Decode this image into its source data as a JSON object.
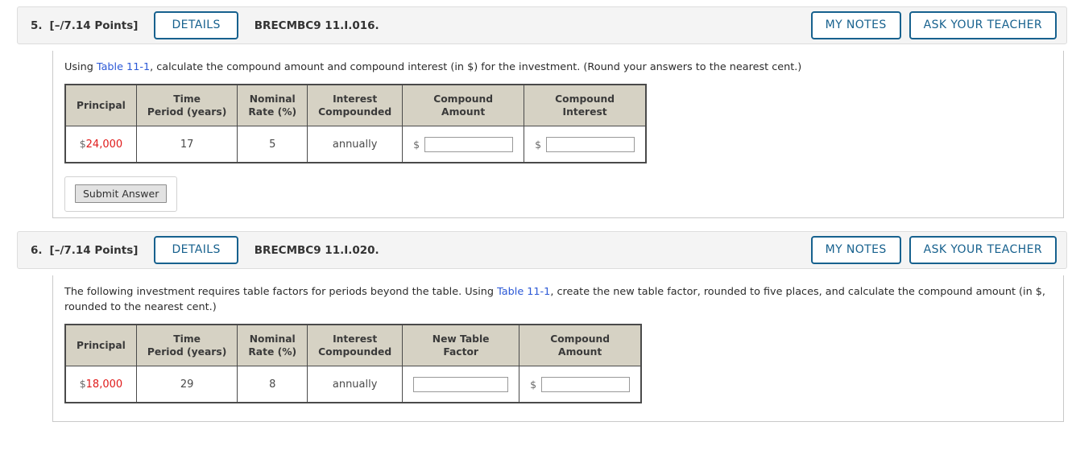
{
  "problems": [
    {
      "number": "5.",
      "points": "[–/7.14 Points]",
      "details_label": "DETAILS",
      "code": "BRECMBC9 11.I.016.",
      "my_notes_label": "MY NOTES",
      "ask_teacher_label": "ASK YOUR TEACHER",
      "question": {
        "before_link": "Using ",
        "link": "Table 11-1",
        "after_link": ", calculate the compound amount and compound interest (in $) for the investment. (Round your answers to the nearest cent.)"
      },
      "table": {
        "headers": [
          "Principal",
          "Time\nPeriod (years)",
          "Nominal\nRate (%)",
          "Interest\nCompounded",
          "Compound\nAmount",
          "Compound\nInterest"
        ],
        "row": {
          "principal_symbol": "$",
          "principal_value": "24,000",
          "time_period": "17",
          "nominal_rate": "5",
          "interest_compounded": "annually",
          "compound_amount_prefix": "$",
          "compound_amount_value": "",
          "compound_interest_prefix": "$",
          "compound_interest_value": ""
        }
      },
      "submit_label": "Submit Answer",
      "has_submit": true
    },
    {
      "number": "6.",
      "points": "[–/7.14 Points]",
      "details_label": "DETAILS",
      "code": "BRECMBC9 11.I.020.",
      "my_notes_label": "MY NOTES",
      "ask_teacher_label": "ASK YOUR TEACHER",
      "question": {
        "before_link": "The following investment requires table factors for periods beyond the table. Using ",
        "link": "Table 11-1",
        "after_link": ", create the new table factor, rounded to five places, and calculate the compound amount (in $, rounded to the nearest cent.)"
      },
      "table": {
        "headers": [
          "Principal",
          "Time\nPeriod (years)",
          "Nominal\nRate (%)",
          "Interest\nCompounded",
          "New Table\nFactor",
          "Compound\nAmount"
        ],
        "row": {
          "principal_symbol": "$",
          "principal_value": "18,000",
          "time_period": "29",
          "nominal_rate": "8",
          "interest_compounded": "annually",
          "new_table_factor_value": "",
          "compound_amount_prefix": "$",
          "compound_amount_value": ""
        }
      },
      "has_submit": false
    }
  ],
  "colors": {
    "accent_blue": "#17618e",
    "link_blue": "#2b58d6",
    "value_red": "#e01b1b",
    "table_header_bg": "#d6d2c4",
    "header_bar_bg": "#f4f4f4"
  }
}
